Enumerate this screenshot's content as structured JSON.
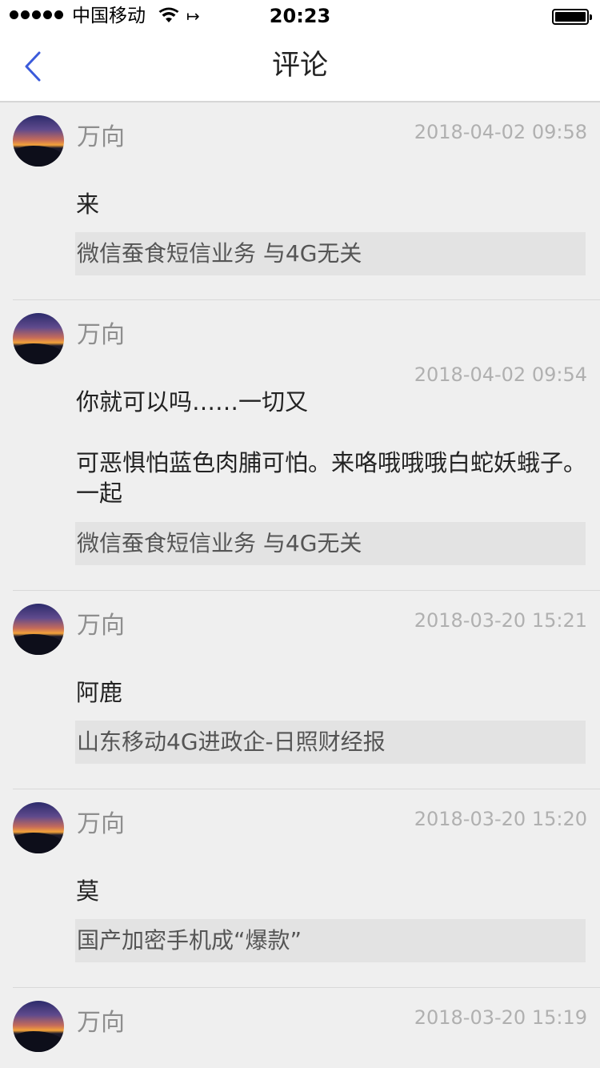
{
  "status_bar": {
    "carrier": "中国移动",
    "time": "20:23",
    "location_glyph": "↦"
  },
  "nav": {
    "title": "评论",
    "back_icon": "chevron-left-icon",
    "accent_color": "#3b5bdb"
  },
  "comments": [
    {
      "author": "万向",
      "time": "2018-04-02 09:58",
      "content": "来",
      "source": "微信蚕食短信业务 与4G无关"
    },
    {
      "author": "万向",
      "time": "2018-04-02 09:54",
      "content": "你就可以吗……一切又\n\n可恶惧怕蓝色肉脯可怕。来咯哦哦哦白蛇妖蛾子。一起",
      "source": "微信蚕食短信业务 与4G无关"
    },
    {
      "author": "万向",
      "time": "2018-03-20 15:21",
      "content": "阿鹿",
      "source": "山东移动4G进政企-日照财经报"
    },
    {
      "author": "万向",
      "time": "2018-03-20 15:20",
      "content": "莫",
      "source": "国产加密手机成“爆款”"
    },
    {
      "author": "万向",
      "time": "2018-03-20 15:19",
      "content": "",
      "source": ""
    }
  ]
}
